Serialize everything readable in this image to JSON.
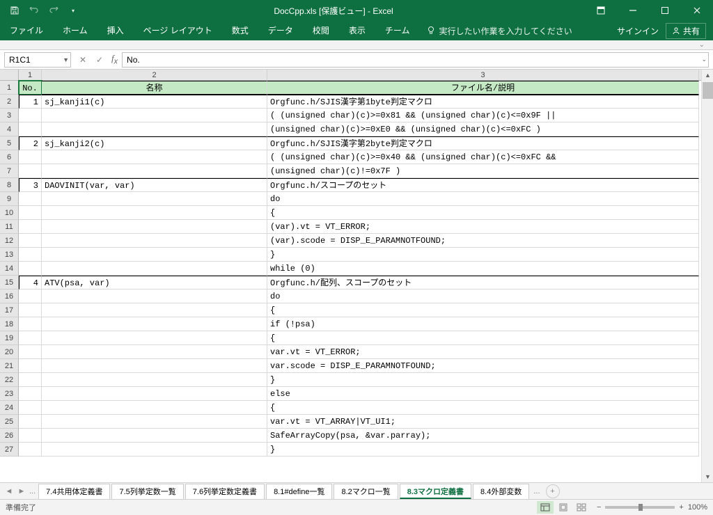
{
  "title": "DocCpp.xls  [保護ビュー] - Excel",
  "ribbon": {
    "tabs": [
      "ファイル",
      "ホーム",
      "挿入",
      "ページ レイアウト",
      "数式",
      "データ",
      "校閲",
      "表示",
      "チーム"
    ],
    "tellme": "実行したい作業を入力してください",
    "signin": "サインイン",
    "share": "共有"
  },
  "namebox": "R1C1",
  "formula": "No.",
  "cols": [
    "1",
    "2",
    "3"
  ],
  "header": {
    "c1": "No.",
    "c2": "名称",
    "c3": "ファイル名/説明"
  },
  "rows": [
    {
      "n": "2",
      "a": "1",
      "b": "sj_kanji1(c)",
      "c": "Orgfunc.h/SJIS漢字第1byte判定マクロ",
      "top": true
    },
    {
      "n": "3",
      "a": "",
      "b": "",
      "c": "  ( (unsigned char)(c)>=0x81 && (unsigned char)(c)<=0x9F ||"
    },
    {
      "n": "4",
      "a": "",
      "b": "",
      "c": "    (unsigned char)(c)>=0xE0 && (unsigned char)(c)<=0xFC )"
    },
    {
      "n": "5",
      "a": "2",
      "b": "sj_kanji2(c)",
      "c": "Orgfunc.h/SJIS漢字第2byte判定マクロ",
      "top": true
    },
    {
      "n": "6",
      "a": "",
      "b": "",
      "c": "  ( (unsigned char)(c)>=0x40 && (unsigned char)(c)<=0xFC &&"
    },
    {
      "n": "7",
      "a": "",
      "b": "",
      "c": "    (unsigned char)(c)!=0x7F )"
    },
    {
      "n": "8",
      "a": "3",
      "b": "DAOVINIT(var, var)",
      "c": "Orgfunc.h/スコープのセット",
      "top": true
    },
    {
      "n": "9",
      "a": "",
      "b": "",
      "c": "    do"
    },
    {
      "n": "10",
      "a": "",
      "b": "",
      "c": "    {"
    },
    {
      "n": "11",
      "a": "",
      "b": "",
      "c": "    (var).vt = VT_ERROR;"
    },
    {
      "n": "12",
      "a": "",
      "b": "",
      "c": "    (var).scode = DISP_E_PARAMNOTFOUND;"
    },
    {
      "n": "13",
      "a": "",
      "b": "",
      "c": "    }"
    },
    {
      "n": "14",
      "a": "",
      "b": "",
      "c": "    while (0)"
    },
    {
      "n": "15",
      "a": "4",
      "b": "ATV(psa, var)",
      "c": "Orgfunc.h/配列、スコープのセット",
      "top": true
    },
    {
      "n": "16",
      "a": "",
      "b": "",
      "c": "    do"
    },
    {
      "n": "17",
      "a": "",
      "b": "",
      "c": "    {"
    },
    {
      "n": "18",
      "a": "",
      "b": "",
      "c": "    if (!psa)"
    },
    {
      "n": "19",
      "a": "",
      "b": "",
      "c": "    {"
    },
    {
      "n": "20",
      "a": "",
      "b": "",
      "c": "    var.vt  = VT_ERROR;"
    },
    {
      "n": "21",
      "a": "",
      "b": "",
      "c": "    var.scode = DISP_E_PARAMNOTFOUND;"
    },
    {
      "n": "22",
      "a": "",
      "b": "",
      "c": "    }"
    },
    {
      "n": "23",
      "a": "",
      "b": "",
      "c": "    else"
    },
    {
      "n": "24",
      "a": "",
      "b": "",
      "c": "    {"
    },
    {
      "n": "25",
      "a": "",
      "b": "",
      "c": "    var.vt  = VT_ARRAY|VT_UI1;"
    },
    {
      "n": "26",
      "a": "",
      "b": "",
      "c": "    SafeArrayCopy(psa, &var.parray);"
    },
    {
      "n": "27",
      "a": "",
      "b": "",
      "c": "    }"
    }
  ],
  "sheets": {
    "list": [
      "7.4共用体定義書",
      "7.5列挙定数一覧",
      "7.6列挙定数定義書",
      "8.1#define一覧",
      "8.2マクロ一覧",
      "8.3マクロ定義書",
      "8.4外部変数"
    ],
    "active": 5,
    "overflow": "..."
  },
  "status": "準備完了",
  "zoom": "100%"
}
